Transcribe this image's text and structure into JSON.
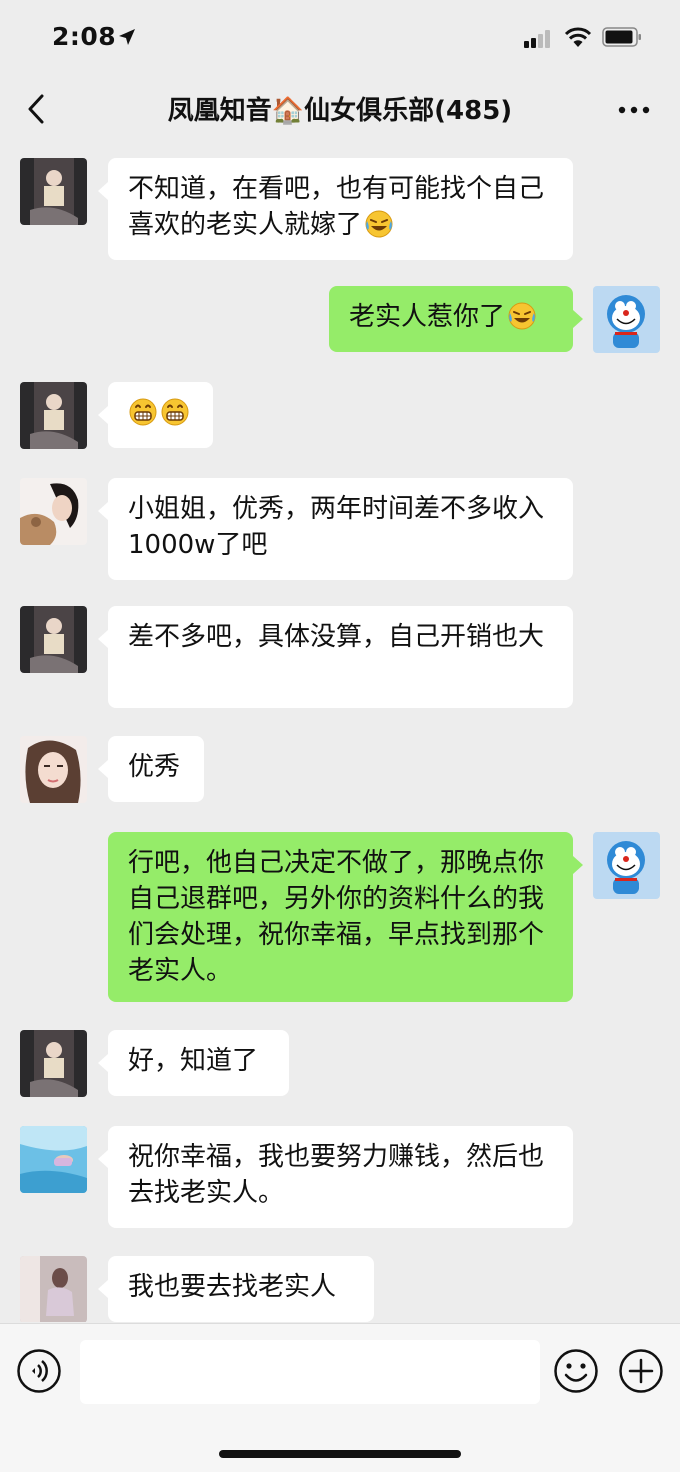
{
  "status": {
    "time": "2:08"
  },
  "nav": {
    "title": "凤凰知音🏠仙女俱乐部(485)"
  },
  "messages": [
    {
      "side": "left",
      "text": "不知道，在看吧，也有可能找个自己喜欢的老实人就嫁了",
      "emoji": "laughing-crying-emoji",
      "avatar": "avatar-a"
    },
    {
      "side": "right",
      "text": "老实人惹你了",
      "emoji": "laughing-crying-emoji",
      "avatar": "avatar-doraemon"
    },
    {
      "side": "left",
      "text": "",
      "emoji": "grin-emoji-x2",
      "avatar": "avatar-a"
    },
    {
      "side": "left",
      "text": "小姐姐，优秀，两年时间差不多收入1000w了吧",
      "avatar": "avatar-b"
    },
    {
      "side": "left",
      "text": "差不多吧，具体没算，自己开销也大",
      "avatar": "avatar-a"
    },
    {
      "side": "left",
      "text": "优秀",
      "avatar": "avatar-c"
    },
    {
      "side": "right",
      "text": "行吧，他自己决定不做了，那晚点你自己退群吧，另外你的资料什么的我们会处理，祝你幸福，早点找到那个老实人。",
      "avatar": "avatar-doraemon"
    },
    {
      "side": "left",
      "text": "好，知道了",
      "avatar": "avatar-a"
    },
    {
      "side": "left",
      "text": "祝你幸福，我也要努力赚钱，然后也去找老实人。",
      "avatar": "avatar-d"
    },
    {
      "side": "left",
      "text": "我也要去找老实人",
      "avatar": "avatar-e"
    }
  ],
  "input": {
    "placeholder": ""
  },
  "colors": {
    "background": "#ededed",
    "bubble_left": "#ffffff",
    "bubble_right": "#95ec69",
    "input_bar": "#f6f6f6"
  }
}
